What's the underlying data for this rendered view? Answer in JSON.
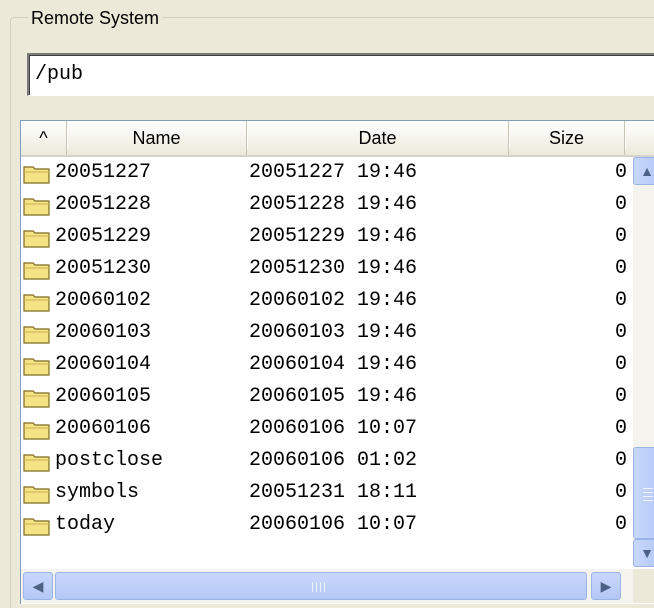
{
  "group": {
    "title": "Remote System"
  },
  "path": {
    "value": "/pub"
  },
  "columns": {
    "sort": "^",
    "name": "Name",
    "date": "Date",
    "size": "Size"
  },
  "icons": {
    "folder": "folder-icon",
    "scroll_up": "up-arrow-icon",
    "scroll_down": "down-arrow-icon",
    "scroll_left": "left-arrow-icon",
    "scroll_right": "right-arrow-icon"
  },
  "colors": {
    "folder_fill": "#f4e487",
    "folder_stroke": "#7d6a1e",
    "scrollbar": "#c1d3fb"
  },
  "files": [
    {
      "name": "20051227",
      "date": "20051227 19:46",
      "size": "0"
    },
    {
      "name": "20051228",
      "date": "20051228 19:46",
      "size": "0"
    },
    {
      "name": "20051229",
      "date": "20051229 19:46",
      "size": "0"
    },
    {
      "name": "20051230",
      "date": "20051230 19:46",
      "size": "0"
    },
    {
      "name": "20060102",
      "date": "20060102 19:46",
      "size": "0"
    },
    {
      "name": "20060103",
      "date": "20060103 19:46",
      "size": "0"
    },
    {
      "name": "20060104",
      "date": "20060104 19:46",
      "size": "0"
    },
    {
      "name": "20060105",
      "date": "20060105 19:46",
      "size": "0"
    },
    {
      "name": "20060106",
      "date": "20060106 10:07",
      "size": "0"
    },
    {
      "name": "postclose",
      "date": "20060106 01:02",
      "size": "0"
    },
    {
      "name": "symbols",
      "date": "20051231 18:11",
      "size": "0"
    },
    {
      "name": "today",
      "date": "20060106 10:07",
      "size": "0"
    }
  ]
}
